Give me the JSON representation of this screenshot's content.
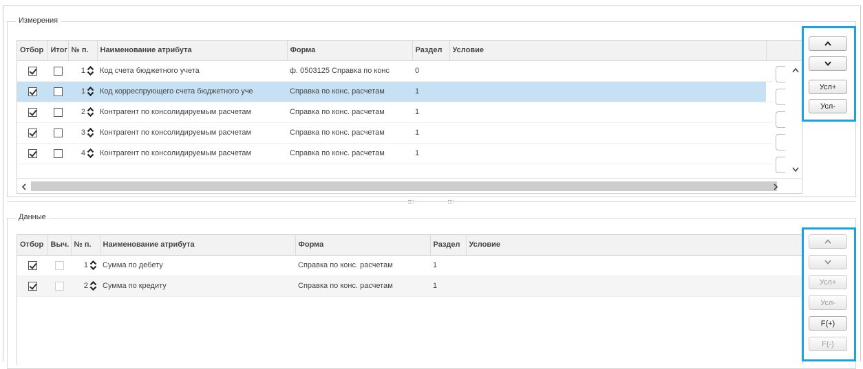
{
  "dimensions": {
    "legend": "Измерения",
    "columns": [
      "Отбор",
      "Итог",
      "№ п.",
      "Наименование атрибута",
      "Форма",
      "Раздел",
      "Условие"
    ],
    "rows": [
      {
        "filter": true,
        "total": false,
        "num": "1",
        "name": "Код счета бюджетного учета",
        "form": "ф. 0503125 Справка по конс",
        "section": "0",
        "condition": "",
        "selected": false
      },
      {
        "filter": true,
        "total": false,
        "num": "1",
        "name": "Код корреспрующего счета бюджетного уче",
        "form": "Справка по конс. расчетам",
        "section": "1",
        "condition": "",
        "selected": true
      },
      {
        "filter": true,
        "total": false,
        "num": "2",
        "name": "Контрагент по консолидируемым расчетам",
        "form": "Справка по конс. расчетам",
        "section": "1",
        "condition": "",
        "selected": false
      },
      {
        "filter": true,
        "total": false,
        "num": "3",
        "name": "Контрагент по консолидируемым расчетам",
        "form": "Справка по конс. расчетам",
        "section": "1",
        "condition": "",
        "selected": false
      },
      {
        "filter": true,
        "total": false,
        "num": "4",
        "name": "Контрагент по консолидируемым расчетам",
        "form": "Справка по конс. расчетам",
        "section": "1",
        "condition": "",
        "selected": false
      }
    ],
    "buttons": {
      "up": "⌃",
      "down": "⌄",
      "cond_add": "Усл+",
      "cond_remove": "Усл-"
    }
  },
  "data": {
    "legend": "Данные",
    "columns": [
      "Отбор",
      "Выч.",
      "№ п.",
      "Наименование атрибута",
      "Форма",
      "Раздел",
      "Условие"
    ],
    "rows": [
      {
        "filter": true,
        "calc": false,
        "num": "1",
        "name": "Сумма по дебету",
        "form": "Справка по конс. расчетам",
        "section": "1",
        "condition": ""
      },
      {
        "filter": true,
        "calc": false,
        "num": "2",
        "name": "Сумма по кредиту",
        "form": "Справка по конс. расчетам",
        "section": "1",
        "condition": ""
      }
    ],
    "buttons": {
      "up": "⌃",
      "down": "⌄",
      "cond_add": "Усл+",
      "cond_remove": "Усл-",
      "func_add": "F(+)",
      "func_remove": "F(-)"
    }
  },
  "colors": {
    "accent_highlight": "#1aa3e0",
    "selected_row": "#c6e1f3"
  }
}
